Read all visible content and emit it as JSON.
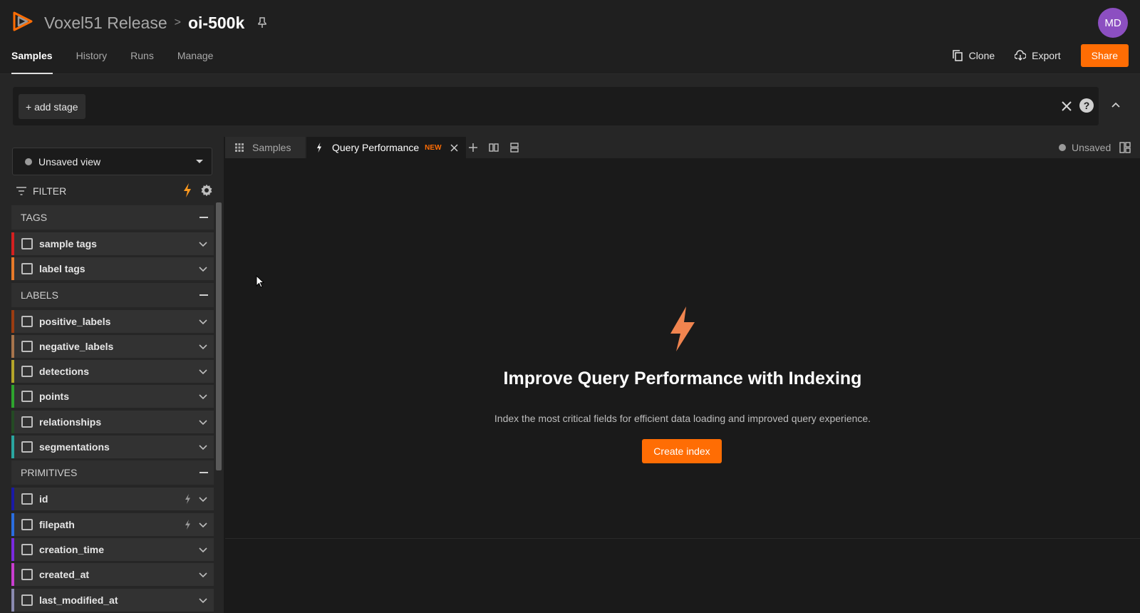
{
  "header": {
    "app_name": "Voxel51 Release",
    "separator": ">",
    "dataset_name": "oi-500k",
    "avatar_initials": "MD",
    "nav_tabs": [
      {
        "label": "Samples",
        "active": true
      },
      {
        "label": "History",
        "active": false
      },
      {
        "label": "Runs",
        "active": false
      },
      {
        "label": "Manage",
        "active": false
      }
    ],
    "actions": {
      "clone_label": "Clone",
      "export_label": "Export",
      "share_label": "Share"
    }
  },
  "stage_bar": {
    "add_stage_label": "+ add stage",
    "help_label": "?"
  },
  "sidebar": {
    "view_select_label": "Unsaved view",
    "filter_label": "FILTER",
    "groups": [
      {
        "title": "TAGS",
        "fields": [
          {
            "label": "sample tags",
            "color": "#d42020",
            "bolt": false
          },
          {
            "label": "label tags",
            "color": "#e87a2a",
            "bolt": false
          }
        ]
      },
      {
        "title": "LABELS",
        "fields": [
          {
            "label": "positive_labels",
            "color": "#9b3d12",
            "bolt": false
          },
          {
            "label": "negative_labels",
            "color": "#a7744c",
            "bolt": false
          },
          {
            "label": "detections",
            "color": "#b4a52a",
            "bolt": false
          },
          {
            "label": "points",
            "color": "#2ea42e",
            "bolt": false
          },
          {
            "label": "relationships",
            "color": "#244a24",
            "bolt": false
          },
          {
            "label": "segmentations",
            "color": "#2aa6a0",
            "bolt": false
          }
        ]
      },
      {
        "title": "PRIMITIVES",
        "fields": [
          {
            "label": "id",
            "color": "#1a1aa6",
            "bolt": true
          },
          {
            "label": "filepath",
            "color": "#2a6ee0",
            "bolt": true
          },
          {
            "label": "creation_time",
            "color": "#7a2ae0",
            "bolt": false
          },
          {
            "label": "created_at",
            "color": "#c93ed0",
            "bolt": false
          },
          {
            "label": "last_modified_at",
            "color": "#8a8ab0",
            "bolt": false
          }
        ]
      }
    ]
  },
  "main": {
    "tabs": [
      {
        "label": "Samples"
      },
      {
        "label": "Query Performance",
        "badge": "NEW"
      }
    ],
    "unsaved_label": "Unsaved",
    "panel": {
      "title": "Improve Query Performance with Indexing",
      "description": "Index the most critical fields for efficient data loading and improved query experience.",
      "button_label": "Create index"
    }
  },
  "colors": {
    "accent": "#ff6d04",
    "background": "#1a1a1a",
    "avatar": "#8c4fc1"
  }
}
